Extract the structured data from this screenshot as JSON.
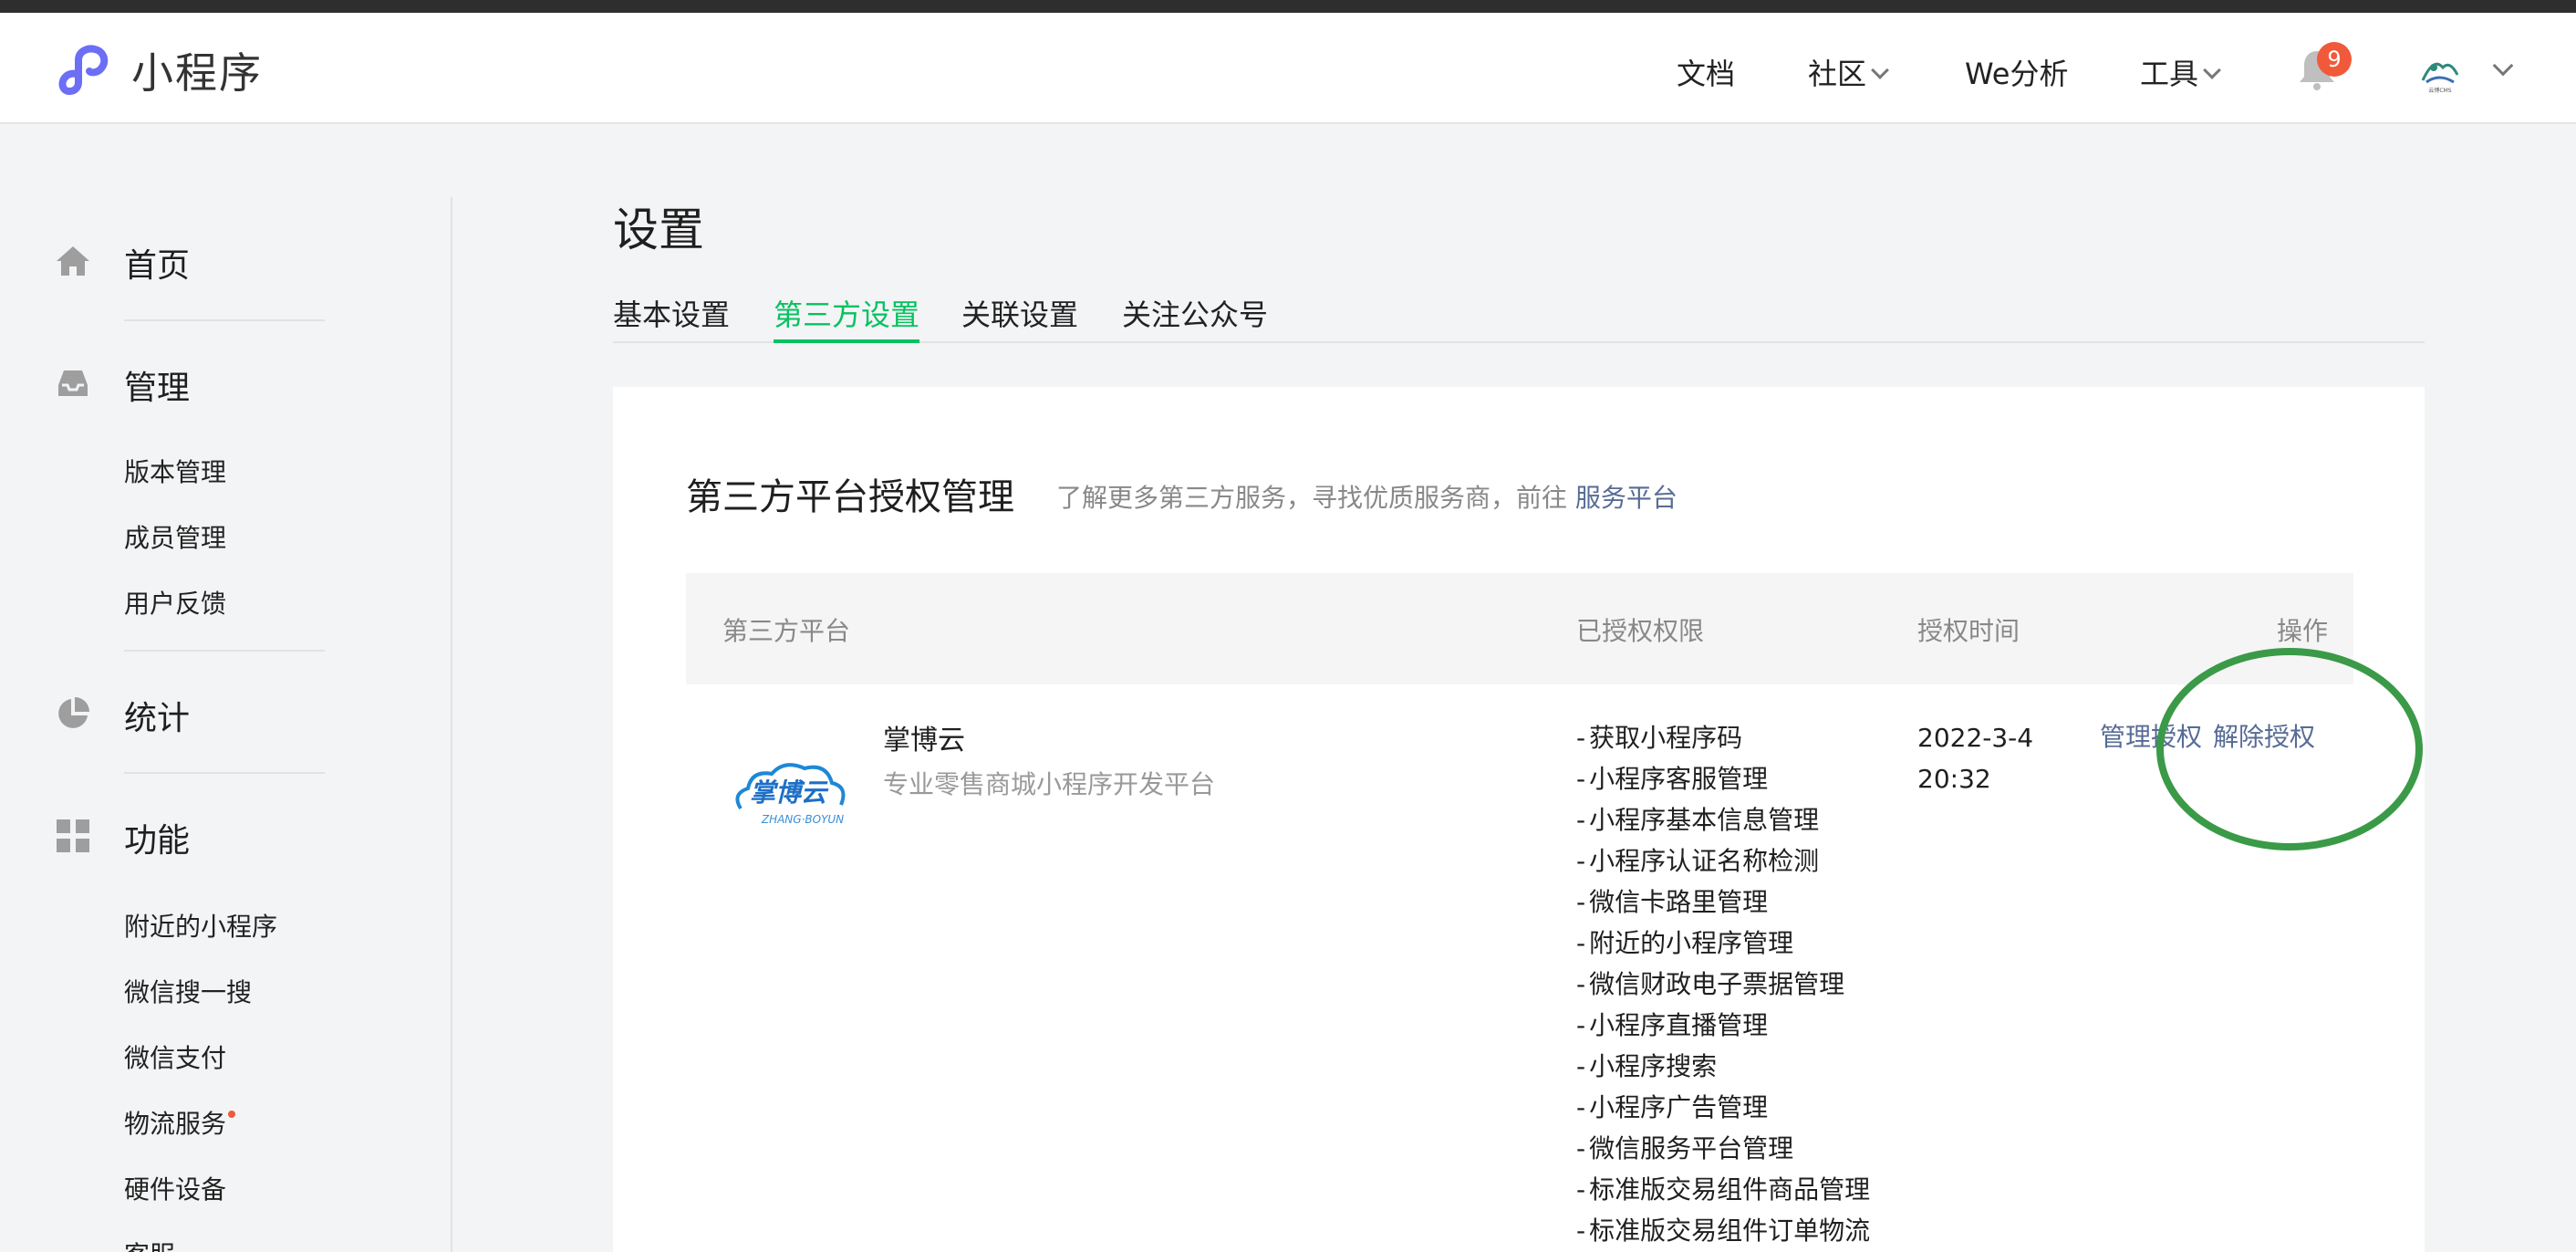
{
  "header": {
    "app_title": "小程序",
    "nav": {
      "docs": "文档",
      "community": "社区",
      "we_analysis": "We分析",
      "tools": "工具"
    },
    "notification_count": "9",
    "avatar_text": "云博CMS"
  },
  "sidebar": {
    "home": "首页",
    "manage": "管理",
    "manage_items": [
      "版本管理",
      "成员管理",
      "用户反馈"
    ],
    "stats": "统计",
    "features": "功能",
    "feature_items": [
      "附近的小程序",
      "微信搜一搜",
      "微信支付",
      "物流服务",
      "硬件设备",
      "客服"
    ]
  },
  "page": {
    "title": "设置",
    "tabs": [
      "基本设置",
      "第三方设置",
      "关联设置",
      "关注公众号"
    ],
    "active_tab": 1
  },
  "card": {
    "title": "第三方平台授权管理",
    "subtitle": "了解更多第三方服务，寻找优质服务商，前往",
    "subtitle_link": "服务平台",
    "columns": [
      "第三方平台",
      "已授权权限",
      "授权时间",
      "操作"
    ],
    "rows": [
      {
        "logo_text": "掌博云",
        "logo_subtext": "ZHANG·BOYUN",
        "name": "掌博云",
        "desc": "专业零售商城小程序开发平台",
        "permissions": [
          "获取小程序码",
          "小程序客服管理",
          "小程序基本信息管理",
          "小程序认证名称检测",
          "微信卡路里管理",
          "附近的小程序管理",
          "微信财政电子票据管理",
          "小程序直播管理",
          "小程序搜索",
          "小程序广告管理",
          "微信服务平台管理",
          "标准版交易组件商品管理",
          "标准版交易组件订单物流"
        ],
        "time_date": "2022-3-4",
        "time_clock": "20:32",
        "action_manage": "管理授权",
        "action_revoke": "解除授权"
      }
    ]
  },
  "colors": {
    "accent_green": "#07c160",
    "link_blue": "#576b95",
    "badge_red": "#f05a3b",
    "annotation_green": "#3a9a47"
  }
}
